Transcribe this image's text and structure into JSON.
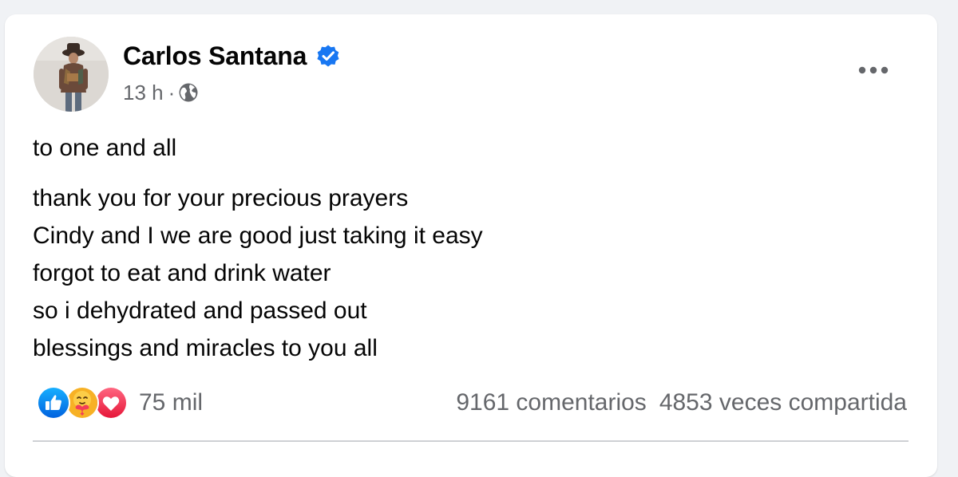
{
  "post": {
    "author": {
      "name": "Carlos Santana",
      "verified_icon": "verified-badge-icon",
      "avatar_icon": "profile-photo"
    },
    "timestamp": "13 h",
    "separator": "·",
    "audience_icon": "globe-icon",
    "more_icon": "more-options-icon",
    "text": {
      "greeting": "to one and all",
      "lines": [
        "thank you for your precious prayers",
        "Cindy and I we are good just taking it easy",
        "forgot to eat and drink water",
        "so i dehydrated and passed out",
        "blessings and miracles to you all"
      ]
    },
    "reactions": {
      "icons": [
        "like-icon",
        "care-icon",
        "love-icon"
      ],
      "count": "75 mil"
    },
    "comments": "9161 comentarios",
    "shares": "4853 veces compartida"
  },
  "colors": {
    "background": "#f0f2f5",
    "card": "#ffffff",
    "text": "#050505",
    "secondary_text": "#65676b",
    "verified_blue": "#1877f2",
    "like_blue": "#1b74e4",
    "love_red": "#f33e58",
    "care_yellow": "#f7b125"
  }
}
